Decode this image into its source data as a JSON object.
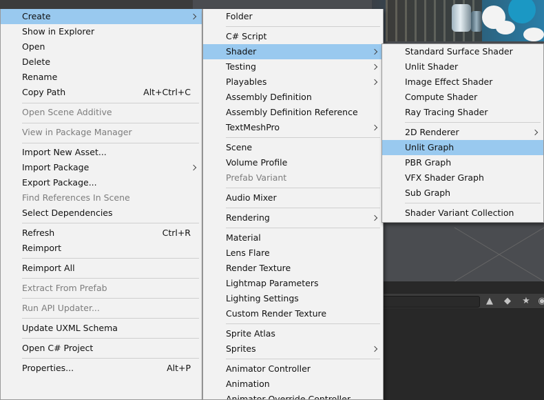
{
  "context_menu": {
    "items": [
      {
        "label": "Create",
        "submenu": true,
        "selected": true
      },
      {
        "label": "Show in Explorer"
      },
      {
        "label": "Open"
      },
      {
        "label": "Delete"
      },
      {
        "label": "Rename"
      },
      {
        "label": "Copy Path",
        "shortcut": "Alt+Ctrl+C"
      },
      {
        "label": "Open Scene Additive",
        "disabled": true
      },
      {
        "label": "View in Package Manager",
        "disabled": true
      },
      {
        "label": "Import New Asset..."
      },
      {
        "label": "Import Package",
        "submenu": true
      },
      {
        "label": "Export Package..."
      },
      {
        "label": "Find References In Scene",
        "disabled": true
      },
      {
        "label": "Select Dependencies"
      },
      {
        "label": "Refresh",
        "shortcut": "Ctrl+R"
      },
      {
        "label": "Reimport"
      },
      {
        "label": "Reimport All"
      },
      {
        "label": "Extract From Prefab",
        "disabled": true
      },
      {
        "label": "Run API Updater...",
        "disabled": true
      },
      {
        "label": "Update UXML Schema"
      },
      {
        "label": "Open C# Project"
      },
      {
        "label": "Properties...",
        "shortcut": "Alt+P"
      }
    ]
  },
  "create_menu": {
    "items": [
      {
        "label": "Folder"
      },
      {
        "label": "C# Script"
      },
      {
        "label": "Shader",
        "submenu": true,
        "selected": true
      },
      {
        "label": "Testing",
        "submenu": true
      },
      {
        "label": "Playables",
        "submenu": true
      },
      {
        "label": "Assembly Definition"
      },
      {
        "label": "Assembly Definition Reference"
      },
      {
        "label": "TextMeshPro",
        "submenu": true
      },
      {
        "label": "Scene"
      },
      {
        "label": "Volume Profile"
      },
      {
        "label": "Prefab Variant",
        "disabled": true
      },
      {
        "label": "Audio Mixer"
      },
      {
        "label": "Rendering",
        "submenu": true
      },
      {
        "label": "Material"
      },
      {
        "label": "Lens Flare"
      },
      {
        "label": "Render Texture"
      },
      {
        "label": "Lightmap Parameters"
      },
      {
        "label": "Lighting Settings"
      },
      {
        "label": "Custom Render Texture"
      },
      {
        "label": "Sprite Atlas"
      },
      {
        "label": "Sprites",
        "submenu": true
      },
      {
        "label": "Animator Controller"
      },
      {
        "label": "Animation"
      },
      {
        "label": "Animator Override Controller"
      }
    ]
  },
  "shader_menu": {
    "items": [
      {
        "label": "Standard Surface Shader"
      },
      {
        "label": "Unlit Shader"
      },
      {
        "label": "Image Effect Shader"
      },
      {
        "label": "Compute Shader"
      },
      {
        "label": "Ray Tracing Shader"
      },
      {
        "label": "2D Renderer",
        "submenu": true
      },
      {
        "label": "Unlit Graph",
        "selected": true
      },
      {
        "label": "PBR Graph"
      },
      {
        "label": "VFX Shader Graph"
      },
      {
        "label": "Sub Graph"
      },
      {
        "label": "Shader Variant Collection"
      }
    ]
  },
  "colors": {
    "menu_bg": "#f2f2f2",
    "selection": "#99c9ef",
    "disabled_text": "#7d7d7d",
    "editor_dark": "#282828"
  }
}
